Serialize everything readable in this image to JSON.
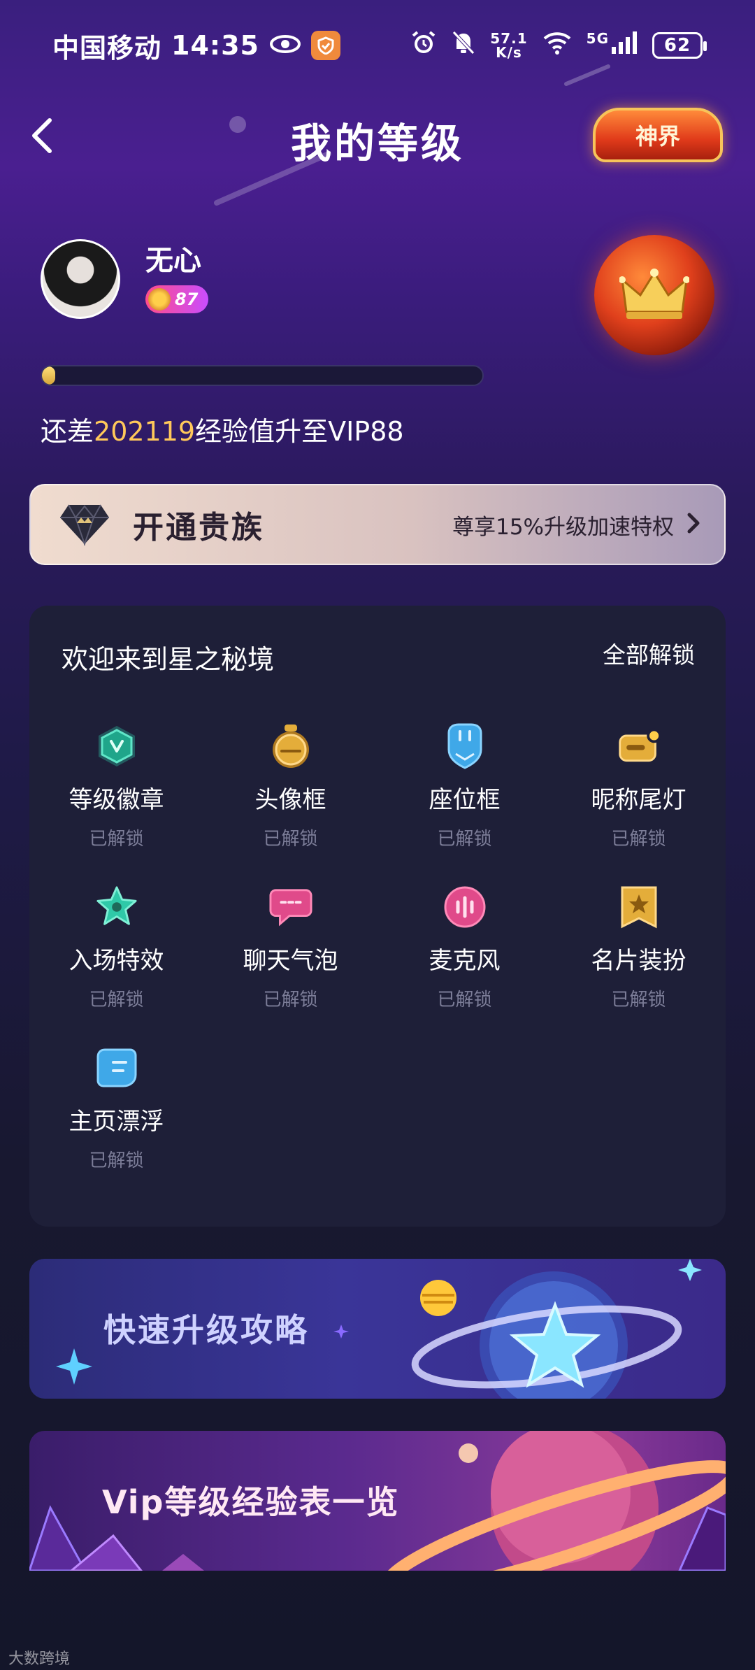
{
  "status_bar": {
    "carrier": "中国移动",
    "time": "14:35",
    "net_speed_value": "57.1",
    "net_speed_unit": "K/s",
    "network": "5G",
    "battery": "62"
  },
  "header": {
    "title": "我的等级",
    "tier_badge": "神界"
  },
  "profile": {
    "username": "无心",
    "level": "87"
  },
  "progress": {
    "fill_fraction": 0.03,
    "text_prefix": "还差",
    "exp_needed": "202119",
    "text_suffix": "经验值升至VIP88"
  },
  "noble": {
    "title": "开通贵族",
    "subtitle": "尊享15%升级加速特权"
  },
  "features": {
    "title": "欢迎来到星之秘境",
    "unlock_all": "全部解锁",
    "items": [
      {
        "label": "等级徽章",
        "state": "已解锁",
        "icon": "badge-icon",
        "color": "#2fc9a8"
      },
      {
        "label": "头像框",
        "state": "已解锁",
        "icon": "avatar-frame-icon",
        "color": "#e4ad3a"
      },
      {
        "label": "座位框",
        "state": "已解锁",
        "icon": "seat-frame-icon",
        "color": "#3fa8e8"
      },
      {
        "label": "昵称尾灯",
        "state": "已解锁",
        "icon": "nickname-light-icon",
        "color": "#e4ad3a"
      },
      {
        "label": "入场特效",
        "state": "已解锁",
        "icon": "entrance-effect-icon",
        "color": "#2fc9a8"
      },
      {
        "label": "聊天气泡",
        "state": "已解锁",
        "icon": "chat-bubble-icon",
        "color": "#e04a8a"
      },
      {
        "label": "麦克风",
        "state": "已解锁",
        "icon": "microphone-icon",
        "color": "#e04a8a"
      },
      {
        "label": "名片装扮",
        "state": "已解锁",
        "icon": "card-decoration-icon",
        "color": "#e4ad3a"
      },
      {
        "label": "主页漂浮",
        "state": "已解锁",
        "icon": "homepage-float-icon",
        "color": "#3fa8e8"
      }
    ]
  },
  "guide": {
    "title": "快速升级攻略"
  },
  "exp_table": {
    "title": "Vip等级经验表一览"
  },
  "watermark": {
    "text": "大数跨境"
  },
  "colors": {
    "accent_gold": "#ffc85a",
    "card_bg": "#1e1f38",
    "muted_text": "#7c7d98"
  }
}
